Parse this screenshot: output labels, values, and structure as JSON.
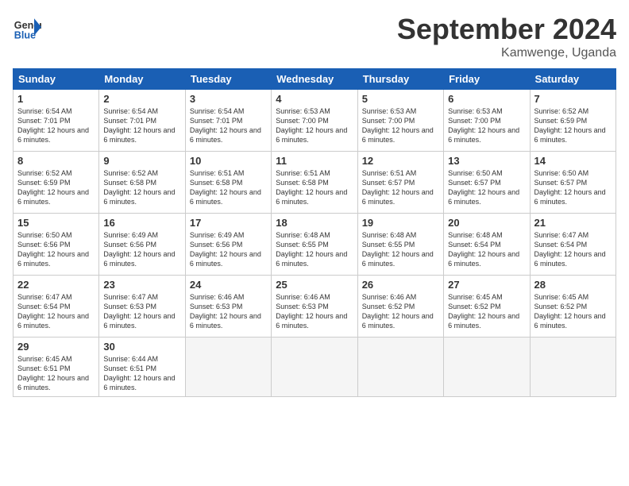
{
  "header": {
    "logo_general": "General",
    "logo_blue": "Blue",
    "month_title": "September 2024",
    "location": "Kamwenge, Uganda"
  },
  "days_of_week": [
    "Sunday",
    "Monday",
    "Tuesday",
    "Wednesday",
    "Thursday",
    "Friday",
    "Saturday"
  ],
  "weeks": [
    [
      {
        "day": "1",
        "sunrise": "6:54 AM",
        "sunset": "7:01 PM",
        "daylight": "12 hours and 6 minutes."
      },
      {
        "day": "2",
        "sunrise": "6:54 AM",
        "sunset": "7:01 PM",
        "daylight": "12 hours and 6 minutes."
      },
      {
        "day": "3",
        "sunrise": "6:54 AM",
        "sunset": "7:01 PM",
        "daylight": "12 hours and 6 minutes."
      },
      {
        "day": "4",
        "sunrise": "6:53 AM",
        "sunset": "7:00 PM",
        "daylight": "12 hours and 6 minutes."
      },
      {
        "day": "5",
        "sunrise": "6:53 AM",
        "sunset": "7:00 PM",
        "daylight": "12 hours and 6 minutes."
      },
      {
        "day": "6",
        "sunrise": "6:53 AM",
        "sunset": "7:00 PM",
        "daylight": "12 hours and 6 minutes."
      },
      {
        "day": "7",
        "sunrise": "6:52 AM",
        "sunset": "6:59 PM",
        "daylight": "12 hours and 6 minutes."
      }
    ],
    [
      {
        "day": "8",
        "sunrise": "6:52 AM",
        "sunset": "6:59 PM",
        "daylight": "12 hours and 6 minutes."
      },
      {
        "day": "9",
        "sunrise": "6:52 AM",
        "sunset": "6:58 PM",
        "daylight": "12 hours and 6 minutes."
      },
      {
        "day": "10",
        "sunrise": "6:51 AM",
        "sunset": "6:58 PM",
        "daylight": "12 hours and 6 minutes."
      },
      {
        "day": "11",
        "sunrise": "6:51 AM",
        "sunset": "6:58 PM",
        "daylight": "12 hours and 6 minutes."
      },
      {
        "day": "12",
        "sunrise": "6:51 AM",
        "sunset": "6:57 PM",
        "daylight": "12 hours and 6 minutes."
      },
      {
        "day": "13",
        "sunrise": "6:50 AM",
        "sunset": "6:57 PM",
        "daylight": "12 hours and 6 minutes."
      },
      {
        "day": "14",
        "sunrise": "6:50 AM",
        "sunset": "6:57 PM",
        "daylight": "12 hours and 6 minutes."
      }
    ],
    [
      {
        "day": "15",
        "sunrise": "6:50 AM",
        "sunset": "6:56 PM",
        "daylight": "12 hours and 6 minutes."
      },
      {
        "day": "16",
        "sunrise": "6:49 AM",
        "sunset": "6:56 PM",
        "daylight": "12 hours and 6 minutes."
      },
      {
        "day": "17",
        "sunrise": "6:49 AM",
        "sunset": "6:56 PM",
        "daylight": "12 hours and 6 minutes."
      },
      {
        "day": "18",
        "sunrise": "6:48 AM",
        "sunset": "6:55 PM",
        "daylight": "12 hours and 6 minutes."
      },
      {
        "day": "19",
        "sunrise": "6:48 AM",
        "sunset": "6:55 PM",
        "daylight": "12 hours and 6 minutes."
      },
      {
        "day": "20",
        "sunrise": "6:48 AM",
        "sunset": "6:54 PM",
        "daylight": "12 hours and 6 minutes."
      },
      {
        "day": "21",
        "sunrise": "6:47 AM",
        "sunset": "6:54 PM",
        "daylight": "12 hours and 6 minutes."
      }
    ],
    [
      {
        "day": "22",
        "sunrise": "6:47 AM",
        "sunset": "6:54 PM",
        "daylight": "12 hours and 6 minutes."
      },
      {
        "day": "23",
        "sunrise": "6:47 AM",
        "sunset": "6:53 PM",
        "daylight": "12 hours and 6 minutes."
      },
      {
        "day": "24",
        "sunrise": "6:46 AM",
        "sunset": "6:53 PM",
        "daylight": "12 hours and 6 minutes."
      },
      {
        "day": "25",
        "sunrise": "6:46 AM",
        "sunset": "6:53 PM",
        "daylight": "12 hours and 6 minutes."
      },
      {
        "day": "26",
        "sunrise": "6:46 AM",
        "sunset": "6:52 PM",
        "daylight": "12 hours and 6 minutes."
      },
      {
        "day": "27",
        "sunrise": "6:45 AM",
        "sunset": "6:52 PM",
        "daylight": "12 hours and 6 minutes."
      },
      {
        "day": "28",
        "sunrise": "6:45 AM",
        "sunset": "6:52 PM",
        "daylight": "12 hours and 6 minutes."
      }
    ],
    [
      {
        "day": "29",
        "sunrise": "6:45 AM",
        "sunset": "6:51 PM",
        "daylight": "12 hours and 6 minutes."
      },
      {
        "day": "30",
        "sunrise": "6:44 AM",
        "sunset": "6:51 PM",
        "daylight": "12 hours and 6 minutes."
      },
      null,
      null,
      null,
      null,
      null
    ]
  ]
}
